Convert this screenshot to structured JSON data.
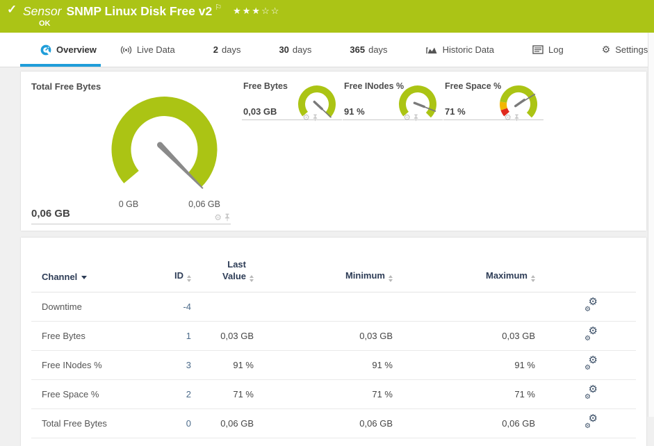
{
  "header": {
    "kind_label": "Sensor",
    "sensor_name": "SNMP Linux Disk Free v2",
    "status": "OK",
    "check_icon": "✓",
    "flag_icon": "⚐",
    "stars_filled": "★★★",
    "stars_empty": "☆☆",
    "rating_filled": 3,
    "rating_total": 5
  },
  "tabs": [
    {
      "label": "Overview"
    },
    {
      "label": "Live Data"
    },
    {
      "num": "2",
      "label": "days"
    },
    {
      "num": "30",
      "label": "days"
    },
    {
      "num": "365",
      "label": "days"
    },
    {
      "label": "Historic Data"
    },
    {
      "label": "Log"
    },
    {
      "label": "Settings"
    }
  ],
  "icons": {
    "gear_glyph": "⚙"
  },
  "gauges": {
    "main": {
      "title": "Total Free Bytes",
      "value": "0,06 GB",
      "scale_min_label": "0 GB",
      "scale_max_label": "0,06 GB"
    },
    "small": [
      {
        "title": "Free Bytes",
        "value": "0,03 GB"
      },
      {
        "title": "Free INodes %",
        "value": "91 %"
      },
      {
        "title": "Free Space %",
        "value": "71 %"
      }
    ]
  },
  "table": {
    "headers": {
      "channel": "Channel",
      "id": "ID",
      "last_value": "Last Value",
      "minimum": "Minimum",
      "maximum": "Maximum"
    },
    "rows": [
      {
        "channel": "Downtime",
        "id": "-4",
        "last": "",
        "min": "",
        "max": ""
      },
      {
        "channel": "Free Bytes",
        "id": "1",
        "last": "0,03 GB",
        "min": "0,03 GB",
        "max": "0,03 GB"
      },
      {
        "channel": "Free INodes %",
        "id": "3",
        "last": "91 %",
        "min": "91 %",
        "max": "91 %"
      },
      {
        "channel": "Free Space %",
        "id": "2",
        "last": "71 %",
        "min": "71 %",
        "max": "71 %"
      },
      {
        "channel": "Total Free Bytes",
        "id": "0",
        "last": "0,06 GB",
        "min": "0,06 GB",
        "max": "0,06 GB"
      }
    ]
  },
  "colors": {
    "status_green": "#abc416",
    "gauge_green": "#abc414",
    "warn_yellow": "#f2b600",
    "alarm_red": "#e02a1d",
    "accent_blue": "#1f9dd9",
    "header_navy": "#2d3c56"
  }
}
